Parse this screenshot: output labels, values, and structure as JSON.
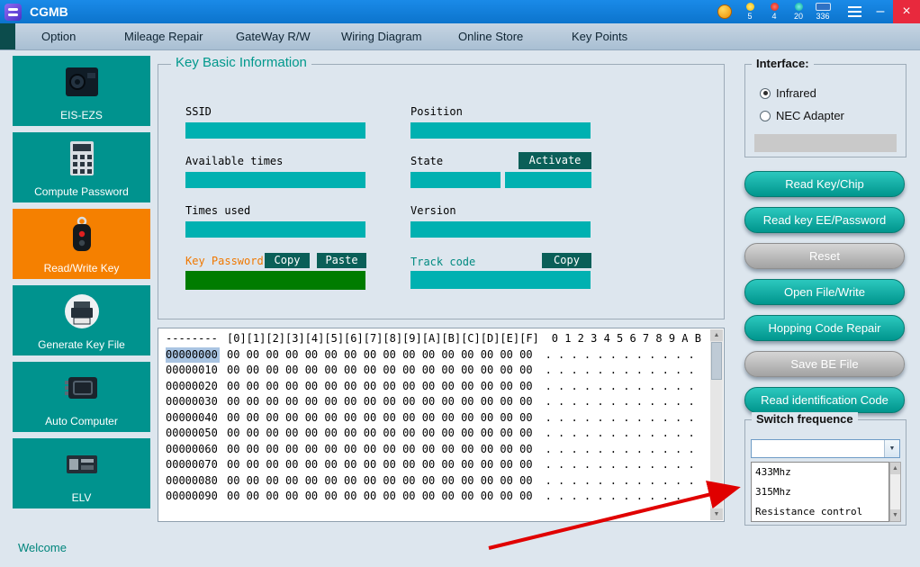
{
  "window": {
    "title": "CGMB",
    "stats": [
      {
        "value": "5",
        "style": "yellow"
      },
      {
        "value": "4",
        "style": "red"
      },
      {
        "value": "20",
        "style": "teal"
      },
      {
        "value": "336",
        "style": "badge"
      }
    ],
    "controls": {
      "minimize": "–",
      "close": "×"
    }
  },
  "menubar": {
    "items": [
      "Option",
      "Mileage Repair",
      "GateWay R/W",
      "Wiring Diagram",
      "Online Store",
      "Key Points"
    ]
  },
  "sidebar": [
    {
      "label": "EIS-EZS"
    },
    {
      "label": "Compute Password"
    },
    {
      "label": "Read/Write Key"
    },
    {
      "label": "Generate Key File"
    },
    {
      "label": "Auto Computer"
    },
    {
      "label": "ELV"
    }
  ],
  "key_info": {
    "title": "Key Basic Information",
    "ssid_label": "SSID",
    "position_label": "Position",
    "available_times_label": "Available times",
    "state_label": "State",
    "activate_button": "Activate",
    "times_used_label": "Times used",
    "version_label": "Version",
    "key_password_label": "Key Password",
    "copy_button": "Copy",
    "paste_button": "Paste",
    "track_code_label": "Track code",
    "track_copy_button": "Copy",
    "values": {
      "ssid": "",
      "position": "",
      "available_times": "",
      "state_1": "",
      "state_2": "",
      "times_used": "",
      "version": "",
      "key_password": "",
      "track_code": ""
    }
  },
  "hex_view": {
    "address_header": "--------",
    "byte_header": "[0][1][2][3][4][5][6][7][8][9][A][B][C][D][E][F]",
    "ascii_header": "0 1 2 3 4 5 6 7 8 9 A B",
    "rows": [
      {
        "address": "00000000",
        "selected": true,
        "bytes": "00 00 00 00 00 00 00 00 00 00 00 00 00 00 00 00",
        "ascii": ". . . . . . . . . . . ."
      },
      {
        "address": "00000010",
        "selected": false,
        "bytes": "00 00 00 00 00 00 00 00 00 00 00 00 00 00 00 00",
        "ascii": ". . . . . . . . . . . ."
      },
      {
        "address": "00000020",
        "selected": false,
        "bytes": "00 00 00 00 00 00 00 00 00 00 00 00 00 00 00 00",
        "ascii": ". . . . . . . . . . . ."
      },
      {
        "address": "00000030",
        "selected": false,
        "bytes": "00 00 00 00 00 00 00 00 00 00 00 00 00 00 00 00",
        "ascii": ". . . . . . . . . . . ."
      },
      {
        "address": "00000040",
        "selected": false,
        "bytes": "00 00 00 00 00 00 00 00 00 00 00 00 00 00 00 00",
        "ascii": ". . . . . . . . . . . ."
      },
      {
        "address": "00000050",
        "selected": false,
        "bytes": "00 00 00 00 00 00 00 00 00 00 00 00 00 00 00 00",
        "ascii": ". . . . . . . . . . . ."
      },
      {
        "address": "00000060",
        "selected": false,
        "bytes": "00 00 00 00 00 00 00 00 00 00 00 00 00 00 00 00",
        "ascii": ". . . . . . . . . . . ."
      },
      {
        "address": "00000070",
        "selected": false,
        "bytes": "00 00 00 00 00 00 00 00 00 00 00 00 00 00 00 00",
        "ascii": ". . . . . . . . . . . ."
      },
      {
        "address": "00000080",
        "selected": false,
        "bytes": "00 00 00 00 00 00 00 00 00 00 00 00 00 00 00 00",
        "ascii": ". . . . . . . . . . . ."
      },
      {
        "address": "00000090",
        "selected": false,
        "bytes": "00 00 00 00 00 00 00 00 00 00 00 00 00 00 00 00",
        "ascii": ". . . . . . . . . . . ."
      }
    ]
  },
  "interface_panel": {
    "title": "Interface:",
    "options": [
      {
        "label": "Infrared",
        "selected": true
      },
      {
        "label": "NEC Adapter",
        "selected": false
      }
    ]
  },
  "action_buttons": [
    {
      "label": "Read Key/Chip",
      "style": "teal"
    },
    {
      "label": "Read key EE/Password",
      "style": "teal"
    },
    {
      "label": "Reset",
      "style": "gray"
    },
    {
      "label": "Open File/Write",
      "style": "teal"
    },
    {
      "label": "Hopping Code Repair",
      "style": "teal"
    },
    {
      "label": "Save BE File",
      "style": "gray"
    },
    {
      "label": "Read identification Code",
      "style": "teal"
    }
  ],
  "switch_frequence": {
    "title": "Switch frequence",
    "combo_value": "",
    "options": [
      "433Mhz",
      "315Mhz",
      "Resistance control"
    ]
  },
  "statusbar": {
    "text": "Welcome"
  },
  "colors": {
    "titlebar_blue": "#0f7fd9",
    "accent_teal": "#00938e",
    "accent_orange": "#f58000",
    "field_teal": "#00b1b1",
    "field_green": "#007c00",
    "dark_button": "#0a5f58",
    "selection_blue": "#a9c4e2",
    "status_text": "#00857c",
    "annotation_red": "#e00000"
  }
}
